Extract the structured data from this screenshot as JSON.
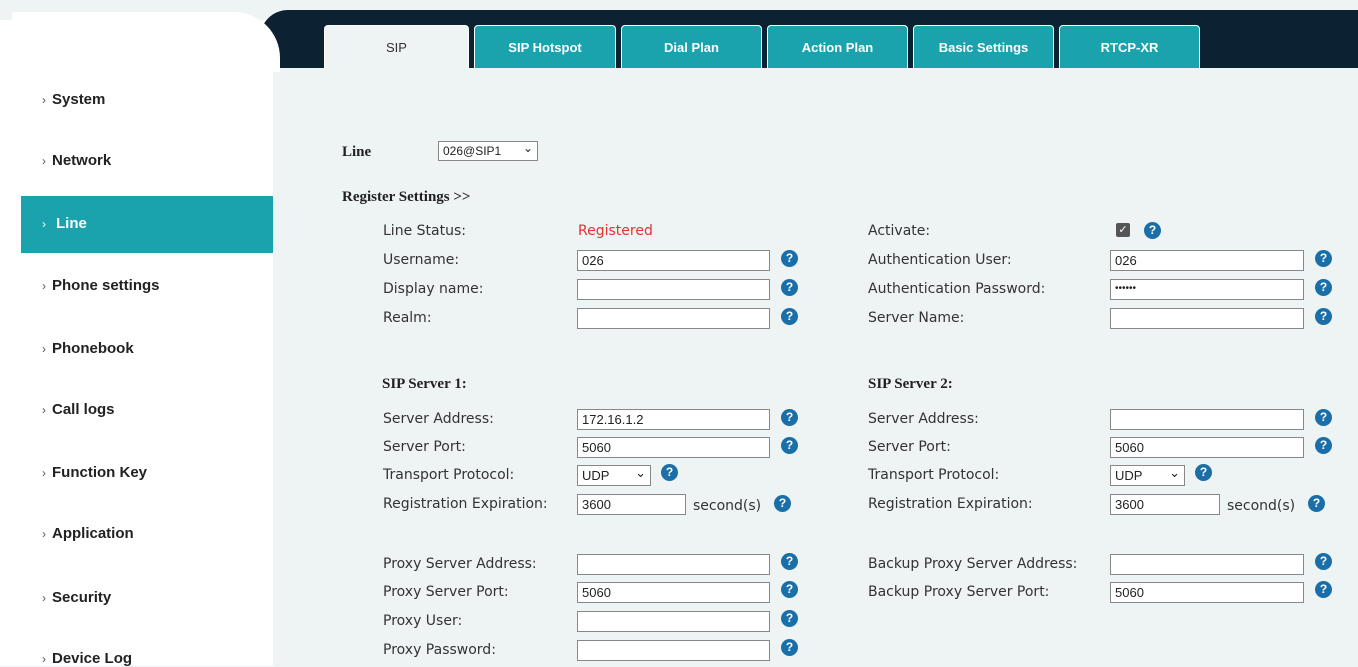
{
  "tabs": [
    "SIP",
    "SIP Hotspot",
    "Dial Plan",
    "Action Plan",
    "Basic Settings",
    "RTCP-XR"
  ],
  "sidebar": {
    "items": [
      {
        "label": "System"
      },
      {
        "label": "Network"
      },
      {
        "label": "Line"
      },
      {
        "label": "Phone settings"
      },
      {
        "label": "Phonebook"
      },
      {
        "label": "Call logs"
      },
      {
        "label": "Function Key"
      },
      {
        "label": "Application"
      },
      {
        "label": "Security"
      },
      {
        "label": "Device Log"
      }
    ]
  },
  "line": {
    "label": "Line",
    "value": "026@SIP1"
  },
  "register": {
    "header": "Register Settings >>",
    "line_status_label": "Line Status:",
    "line_status_value": "Registered",
    "activate_label": "Activate:",
    "username_label": "Username:",
    "username_value": "026",
    "auth_user_label": "Authentication User:",
    "auth_user_value": "026",
    "display_name_label": "Display name:",
    "display_name_value": "",
    "auth_password_label": "Authentication Password:",
    "auth_password_value": "••••••",
    "realm_label": "Realm:",
    "realm_value": "",
    "server_name_label": "Server Name:",
    "server_name_value": ""
  },
  "server1": {
    "title": "SIP Server 1:",
    "address_label": "Server Address:",
    "address_value": "172.16.1.2",
    "port_label": "Server Port:",
    "port_value": "5060",
    "transport_label": "Transport Protocol:",
    "transport_value": "UDP",
    "expiration_label": "Registration Expiration:",
    "expiration_value": "3600",
    "unit": "second(s)"
  },
  "server2": {
    "title": "SIP Server 2:",
    "address_label": "Server Address:",
    "address_value": "",
    "port_label": "Server Port:",
    "port_value": "5060",
    "transport_label": "Transport Protocol:",
    "transport_value": "UDP",
    "expiration_label": "Registration Expiration:",
    "expiration_value": "3600",
    "unit": "second(s)"
  },
  "proxy": {
    "address_label": "Proxy Server Address:",
    "address_value": "",
    "port_label": "Proxy Server Port:",
    "port_value": "5060",
    "user_label": "Proxy User:",
    "user_value": "",
    "password_label": "Proxy Password:",
    "password_value": "",
    "backup_address_label": "Backup Proxy Server Address:",
    "backup_address_value": "",
    "backup_port_label": "Backup Proxy Server Port:",
    "backup_port_value": "5060"
  },
  "help_glyph": "?",
  "chevron": "›",
  "dropdown_arrow": "⌄",
  "check_glyph": "✓"
}
